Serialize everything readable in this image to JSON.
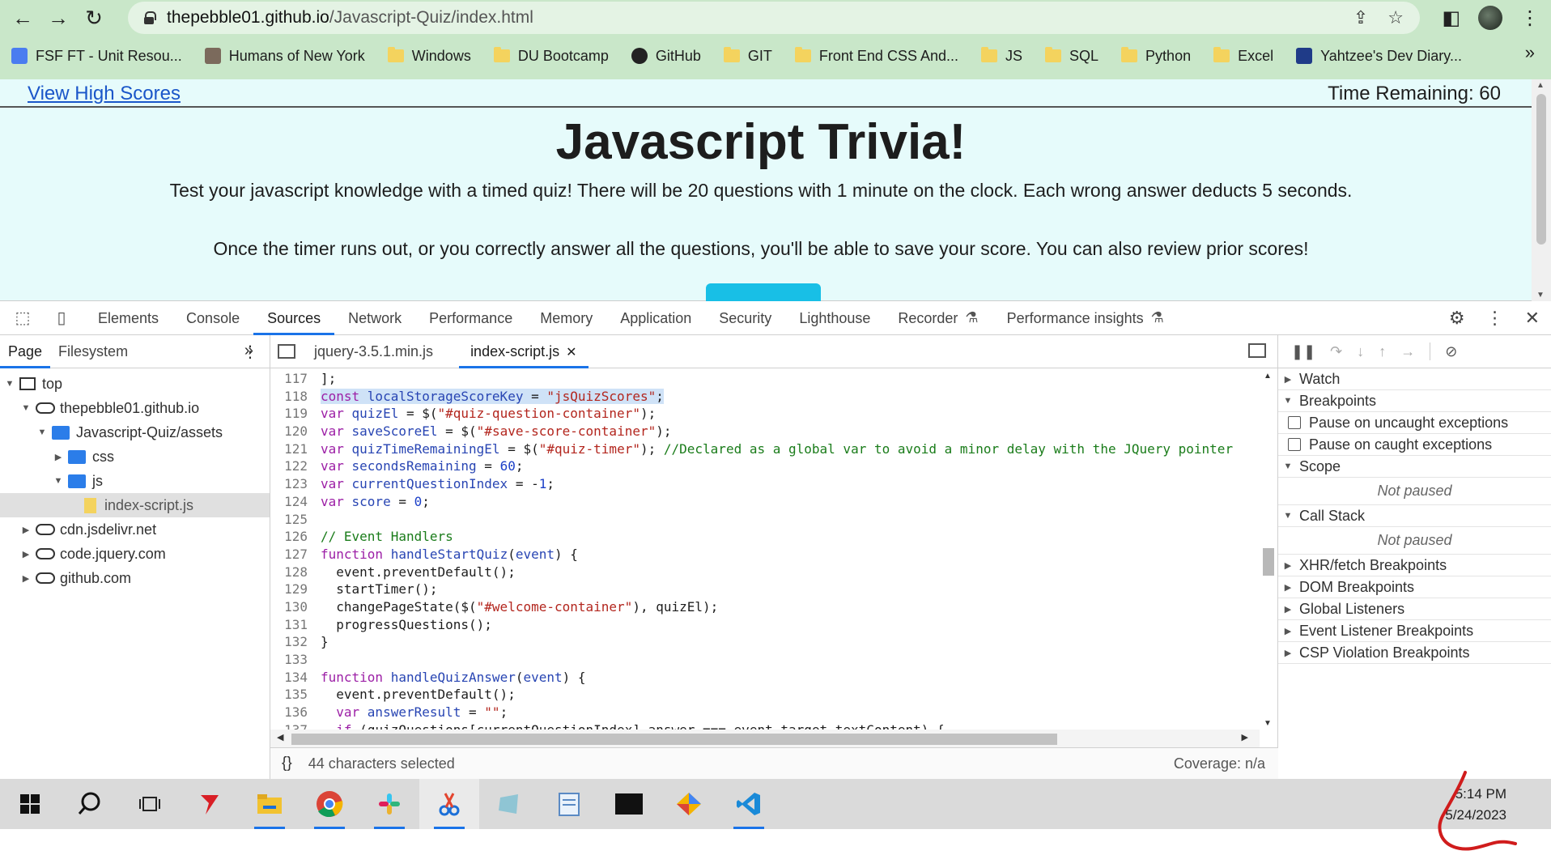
{
  "browser": {
    "url_host": "thepebble01.github.io",
    "url_path": "/Javascript-Quiz/index.html",
    "bookmarks": [
      {
        "label": "FSF FT - Unit Resou...",
        "icon": "doc-icon"
      },
      {
        "label": "Humans of New York",
        "icon": "site-icon"
      },
      {
        "label": "Windows",
        "icon": "folder-icon"
      },
      {
        "label": "DU Bootcamp",
        "icon": "folder-icon"
      },
      {
        "label": "GitHub",
        "icon": "github-icon"
      },
      {
        "label": "GIT",
        "icon": "folder-icon"
      },
      {
        "label": "Front End CSS And...",
        "icon": "folder-icon"
      },
      {
        "label": "JS",
        "icon": "folder-icon"
      },
      {
        "label": "SQL",
        "icon": "folder-icon"
      },
      {
        "label": "Python",
        "icon": "folder-icon"
      },
      {
        "label": "Excel",
        "icon": "folder-icon"
      },
      {
        "label": "Yahtzee's Dev Diary...",
        "icon": "site-icon"
      }
    ],
    "more_bookmarks": "»"
  },
  "page": {
    "high_scores_link": "View High Scores",
    "time_remaining": "Time Remaining: 60",
    "title": "Javascript Trivia!",
    "desc1": "Test your javascript knowledge with a timed quiz! There will be 20 questions with 1 minute on the clock. Each wrong answer deducts 5 seconds.",
    "desc2": "Once the timer runs out, or you correctly answer all the questions, you'll be able to save your score. You can also review prior scores!"
  },
  "devtools": {
    "tabs": [
      "Elements",
      "Console",
      "Sources",
      "Network",
      "Performance",
      "Memory",
      "Application",
      "Security",
      "Lighthouse",
      "Recorder",
      "Performance insights"
    ],
    "active_tab": "Sources",
    "nav_tabs": [
      "Page",
      "Filesystem"
    ],
    "tree": [
      {
        "label": "top",
        "depth": 0,
        "open": true,
        "icon": "frame"
      },
      {
        "label": "thepebble01.github.io",
        "depth": 1,
        "open": true,
        "icon": "cloud"
      },
      {
        "label": "Javascript-Quiz/assets",
        "depth": 2,
        "open": true,
        "icon": "folder"
      },
      {
        "label": "css",
        "depth": 3,
        "open": false,
        "icon": "folder"
      },
      {
        "label": "js",
        "depth": 3,
        "open": true,
        "icon": "folder"
      },
      {
        "label": "index-script.js",
        "depth": 4,
        "open": null,
        "icon": "file",
        "selected": true
      },
      {
        "label": "cdn.jsdelivr.net",
        "depth": 1,
        "open": false,
        "icon": "cloud"
      },
      {
        "label": "code.jquery.com",
        "depth": 1,
        "open": false,
        "icon": "cloud"
      },
      {
        "label": "github.com",
        "depth": 1,
        "open": false,
        "icon": "cloud"
      }
    ],
    "editor_tabs": [
      "jquery-3.5.1.min.js",
      "index-script.js"
    ],
    "active_editor_tab": "index-script.js",
    "code": [
      {
        "n": "117",
        "t": [
          [
            "p",
            "];"
          ]
        ]
      },
      {
        "n": "118",
        "hl": true,
        "t": [
          [
            "k",
            "const "
          ],
          [
            "v",
            "localStorageScoreKey"
          ],
          [
            "p",
            " = "
          ],
          [
            "s",
            "\"jsQuizScores\""
          ],
          [
            "p",
            ";"
          ]
        ]
      },
      {
        "n": "119",
        "t": [
          [
            "k",
            "var "
          ],
          [
            "v",
            "quizEl"
          ],
          [
            "p",
            " = $("
          ],
          [
            "s",
            "\"#quiz-question-container\""
          ],
          [
            "p",
            ");"
          ]
        ]
      },
      {
        "n": "120",
        "t": [
          [
            "k",
            "var "
          ],
          [
            "v",
            "saveScoreEl"
          ],
          [
            "p",
            " = $("
          ],
          [
            "s",
            "\"#save-score-container\""
          ],
          [
            "p",
            ");"
          ]
        ]
      },
      {
        "n": "121",
        "t": [
          [
            "k",
            "var "
          ],
          [
            "v",
            "quizTimeRemainingEl"
          ],
          [
            "p",
            " = $("
          ],
          [
            "s",
            "\"#quiz-timer\""
          ],
          [
            "p",
            "); "
          ],
          [
            "c",
            "//Declared as a global var to avoid a minor delay with the JQuery pointer"
          ]
        ]
      },
      {
        "n": "122",
        "t": [
          [
            "k",
            "var "
          ],
          [
            "v",
            "secondsRemaining"
          ],
          [
            "p",
            " = "
          ],
          [
            "n",
            "60"
          ],
          [
            "p",
            ";"
          ]
        ]
      },
      {
        "n": "123",
        "t": [
          [
            "k",
            "var "
          ],
          [
            "v",
            "currentQuestionIndex"
          ],
          [
            "p",
            " = -"
          ],
          [
            "n",
            "1"
          ],
          [
            "p",
            ";"
          ]
        ]
      },
      {
        "n": "124",
        "t": [
          [
            "k",
            "var "
          ],
          [
            "v",
            "score"
          ],
          [
            "p",
            " = "
          ],
          [
            "n",
            "0"
          ],
          [
            "p",
            ";"
          ]
        ]
      },
      {
        "n": "125",
        "t": [
          [
            "p",
            ""
          ]
        ]
      },
      {
        "n": "126",
        "t": [
          [
            "c",
            "// Event Handlers"
          ]
        ]
      },
      {
        "n": "127",
        "t": [
          [
            "k",
            "function "
          ],
          [
            "v",
            "handleStartQuiz"
          ],
          [
            "p",
            "("
          ],
          [
            "v",
            "event"
          ],
          [
            "p",
            ") {"
          ]
        ]
      },
      {
        "n": "128",
        "t": [
          [
            "p",
            "  event.preventDefault();"
          ]
        ]
      },
      {
        "n": "129",
        "t": [
          [
            "p",
            "  startTimer();"
          ]
        ]
      },
      {
        "n": "130",
        "t": [
          [
            "p",
            "  changePageState($("
          ],
          [
            "s",
            "\"#welcome-container\""
          ],
          [
            "p",
            "), quizEl);"
          ]
        ]
      },
      {
        "n": "131",
        "t": [
          [
            "p",
            "  progressQuestions();"
          ]
        ]
      },
      {
        "n": "132",
        "t": [
          [
            "p",
            "}"
          ]
        ]
      },
      {
        "n": "133",
        "t": [
          [
            "p",
            ""
          ]
        ]
      },
      {
        "n": "134",
        "t": [
          [
            "k",
            "function "
          ],
          [
            "v",
            "handleQuizAnswer"
          ],
          [
            "p",
            "("
          ],
          [
            "v",
            "event"
          ],
          [
            "p",
            ") {"
          ]
        ]
      },
      {
        "n": "135",
        "t": [
          [
            "p",
            "  event.preventDefault();"
          ]
        ]
      },
      {
        "n": "136",
        "t": [
          [
            "k",
            "  var "
          ],
          [
            "v",
            "answerResult"
          ],
          [
            "p",
            " = "
          ],
          [
            "s",
            "\"\""
          ],
          [
            "p",
            ";"
          ]
        ]
      },
      {
        "n": "137",
        "t": [
          [
            "k",
            "  if "
          ],
          [
            "p",
            "(quizQuestions[currentQuestionIndex].answer === event.target.textContent) {"
          ]
        ]
      }
    ],
    "status_selected": "44 characters selected",
    "status_coverage": "Coverage: n/a",
    "braces": "{}",
    "debug": {
      "watch": "Watch",
      "breakpoints": "Breakpoints",
      "pause_uncaught": "Pause on uncaught exceptions",
      "pause_caught": "Pause on caught exceptions",
      "scope": "Scope",
      "not_paused": "Not paused",
      "call_stack": "Call Stack",
      "not_paused2": "Not paused",
      "xhr": "XHR/fetch Breakpoints",
      "dom": "DOM Breakpoints",
      "global": "Global Listeners",
      "event": "Event Listener Breakpoints",
      "csp": "CSP Violation Breakpoints"
    }
  },
  "taskbar": {
    "time": "5:14 PM",
    "date": "5/24/2023"
  },
  "colors": {
    "accent": "#1a73e8",
    "chrome_bg": "#c9e7c9",
    "page_bg": "#e6fbfb",
    "start_button": "#18bfe6"
  }
}
